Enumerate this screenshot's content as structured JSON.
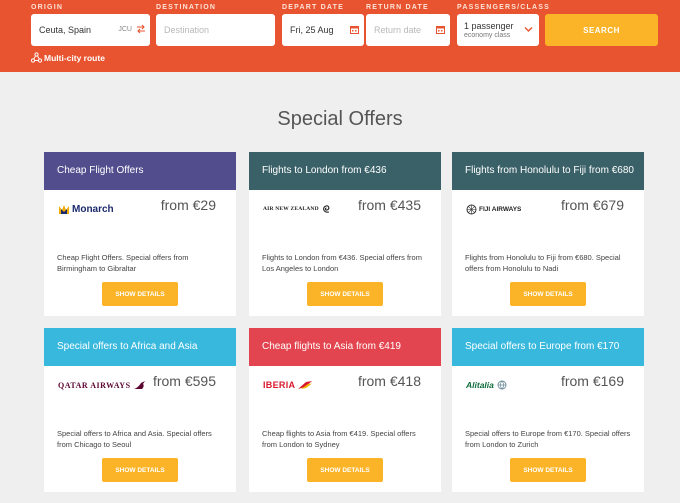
{
  "search": {
    "origin": {
      "label": "ORIGIN",
      "value": "Ceuta, Spain",
      "code": "JCU"
    },
    "destination": {
      "label": "DESTINATION",
      "placeholder": "Destination"
    },
    "depart": {
      "label": "DEPART DATE",
      "value": "Fri, 25 Aug"
    },
    "return": {
      "label": "RETURN DATE",
      "placeholder": "Return date"
    },
    "passengers": {
      "label": "PASSENGERS/CLASS",
      "count": "1 passenger",
      "class": "economy class"
    },
    "search_label": "SEARCH",
    "multicity_label": "Multi-city route"
  },
  "page_title": "Special Offers",
  "colors": {
    "brand_orange": "#e8542f",
    "button_yellow": "#fbb428"
  },
  "offers": [
    {
      "header": "Cheap Flight Offers",
      "header_color": "#524e8e",
      "airline": "Monarch",
      "price": "from €29",
      "description": "Cheap Flight Offers. Special offers from Birmingham to Gibraltar",
      "button": "SHOW DETAILS"
    },
    {
      "header": "Flights to London from €436",
      "header_color": "#3a6168",
      "airline": "AIR NEW ZEALAND",
      "price": "from €435",
      "description": "Flights to London from €436. Special offers from Los Angeles to London",
      "button": "SHOW DETAILS"
    },
    {
      "header": "Flights from Honolulu to Fiji from €680",
      "header_color": "#3a6168",
      "airline": "FIJI AIRWAYS",
      "price": "from €679",
      "description": "Flights from Honolulu to Fiji from €680. Special offers from Honolulu to Nadi",
      "button": "SHOW DETAILS"
    },
    {
      "header": "Special offers to Africa and Asia",
      "header_color": "#38b8dc",
      "airline": "QATAR AIRWAYS",
      "price": "from €595",
      "description": "Special offers to Africa and Asia. Special offers from Chicago to Seoul",
      "button": "SHOW DETAILS"
    },
    {
      "header": "Cheap flights to Asia from €419",
      "header_color": "#e2454f",
      "airline": "IBERIA",
      "price": "from €418",
      "description": "Cheap flights to Asia from €419. Special offers from London to Sydney",
      "button": "SHOW DETAILS"
    },
    {
      "header": "Special offers to Europe from €170",
      "header_color": "#38b8dc",
      "airline": "Alitalia",
      "price": "from €169",
      "description": "Special offers to Europe from €170. Special offers from London to Zurich",
      "button": "SHOW DETAILS"
    }
  ]
}
